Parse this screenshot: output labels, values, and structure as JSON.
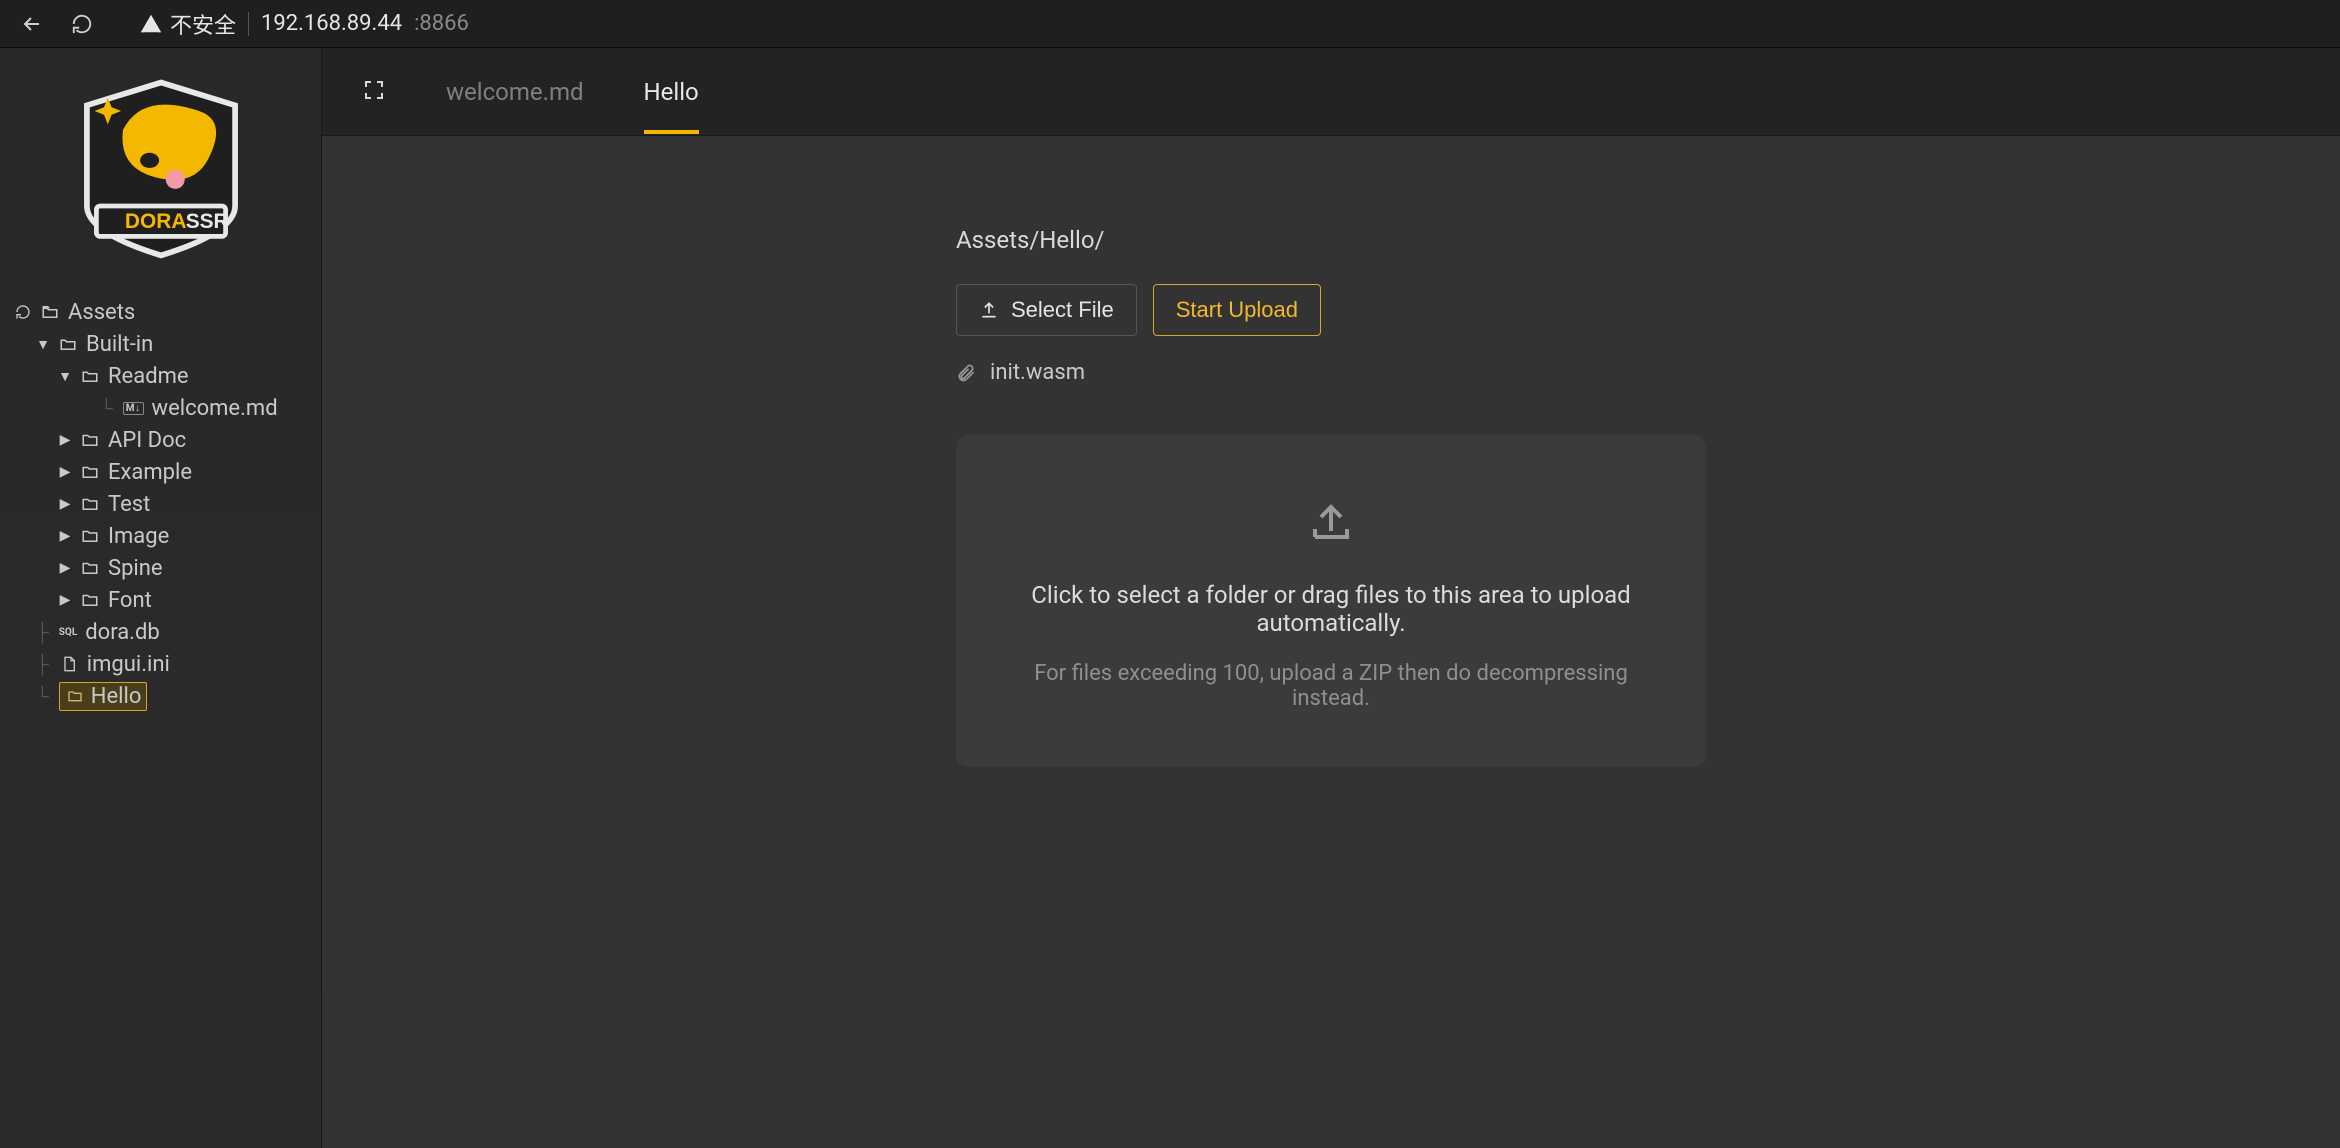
{
  "browser": {
    "insecure_label": "不安全",
    "host": "192.168.89.44",
    "port": ":8866"
  },
  "sidebar": {
    "root": "Assets",
    "builtin": "Built-in",
    "readme": "Readme",
    "welcome_md": "welcome.md",
    "api_doc": "API Doc",
    "example": "Example",
    "test": "Test",
    "image": "Image",
    "spine": "Spine",
    "font": "Font",
    "dora_db": "dora.db",
    "imgui_ini": "imgui.ini",
    "hello": "Hello"
  },
  "tabs": {
    "welcome": "welcome.md",
    "hello": "Hello"
  },
  "upload": {
    "path": "Assets/Hello/",
    "select_file": "Select File",
    "start_upload": "Start Upload",
    "attached_file": "init.wasm",
    "dz_title": "Click to select a folder or drag files to this area to upload automatically.",
    "dz_sub": "For files exceeding 100, upload a ZIP then do decompressing instead."
  }
}
